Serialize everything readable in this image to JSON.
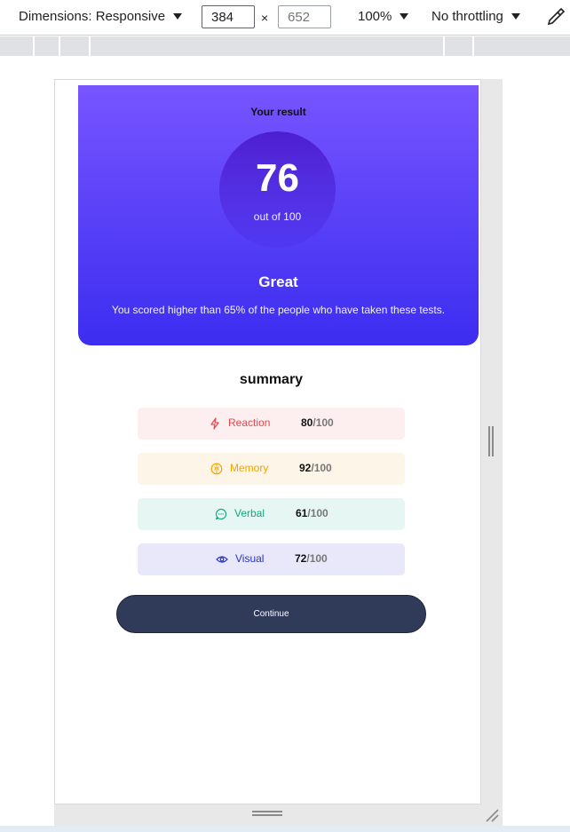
{
  "devtools": {
    "dimensions_label": "Dimensions: Responsive",
    "width_value": "384",
    "height_placeholder": "652",
    "times": "×",
    "zoom": "100%",
    "throttle": "No throttling"
  },
  "result": {
    "heading": "Your result",
    "score": "76",
    "out_of": "out of 100",
    "rating": "Great",
    "description": "You scored higher than 65% of the people who have taken these tests."
  },
  "summary": {
    "title": "summary",
    "items": [
      {
        "label": "Reaction",
        "score": "80",
        "max": "/100",
        "color": "#e5484d",
        "icon": "lightning-icon"
      },
      {
        "label": "Memory",
        "score": "92",
        "max": "/100",
        "color": "#f0a500",
        "icon": "brain-icon"
      },
      {
        "label": "Verbal",
        "score": "61",
        "max": "/100",
        "color": "#12a77b",
        "icon": "chat-icon"
      },
      {
        "label": "Visual",
        "score": "72",
        "max": "/100",
        "color": "#2a2fbf",
        "icon": "eye-icon"
      }
    ]
  },
  "continue_label": "Continue",
  "colors": {
    "gradient_top": "#7755ff",
    "gradient_bottom": "#3c2df0",
    "button": "#303b5a"
  }
}
